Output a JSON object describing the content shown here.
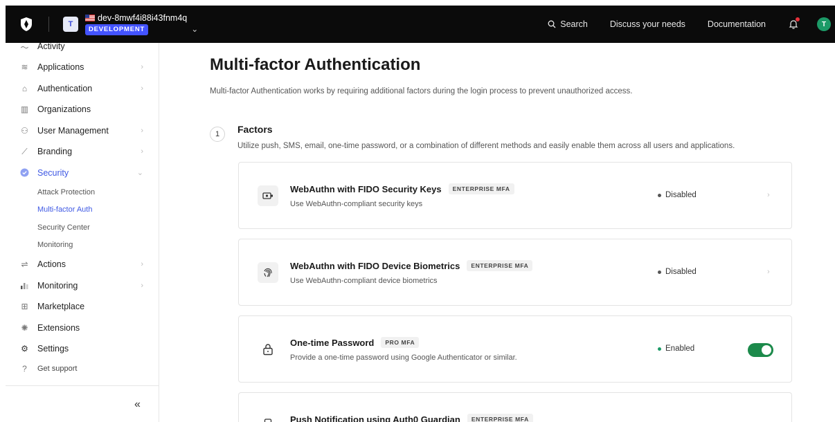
{
  "topbar": {
    "tenant_initial": "T",
    "tenant_name": "dev-8mwf4i88i43fnm4q",
    "environment": "DEVELOPMENT",
    "search_label": "Search",
    "discuss_label": "Discuss your needs",
    "docs_label": "Documentation",
    "user_initial": "T"
  },
  "sidebar": {
    "items": [
      {
        "label": "Activity",
        "icon": "activity-icon"
      },
      {
        "label": "Applications",
        "icon": "layers-icon"
      },
      {
        "label": "Authentication",
        "icon": "lock-icon"
      },
      {
        "label": "Organizations",
        "icon": "building-icon"
      },
      {
        "label": "User Management",
        "icon": "users-icon"
      },
      {
        "label": "Branding",
        "icon": "brush-icon"
      },
      {
        "label": "Security",
        "icon": "shield-check-icon"
      }
    ],
    "security_sub": [
      "Attack Protection",
      "Multi-factor Auth",
      "Security Center",
      "Monitoring"
    ],
    "items_after": [
      {
        "label": "Actions",
        "icon": "actions-icon"
      },
      {
        "label": "Monitoring",
        "icon": "bar-chart-icon"
      },
      {
        "label": "Marketplace",
        "icon": "grid-plus-icon"
      },
      {
        "label": "Extensions",
        "icon": "puzzle-icon"
      },
      {
        "label": "Settings",
        "icon": "gear-icon"
      },
      {
        "label": "Get support",
        "icon": "help-icon"
      }
    ],
    "collapse_glyph": "«"
  },
  "main": {
    "title": "Multi-factor Authentication",
    "description": "Multi-factor Authentication works by requiring additional factors during the login process to prevent unauthorized access.",
    "section": {
      "number": "1",
      "title": "Factors",
      "description": "Utilize push, SMS, email, one-time password, or a combination of different methods and easily enable them across all users and applications."
    },
    "factors": [
      {
        "title": "WebAuthn with FIDO Security Keys",
        "badge": "ENTERPRISE MFA",
        "description": "Use WebAuthn-compliant security keys",
        "status": "Disabled",
        "icon": "security-key-icon"
      },
      {
        "title": "WebAuthn with FIDO Device Biometrics",
        "badge": "ENTERPRISE MFA",
        "description": "Use WebAuthn-compliant device biometrics",
        "status": "Disabled",
        "icon": "fingerprint-icon"
      },
      {
        "title": "One-time Password",
        "badge": "PRO MFA",
        "description": "Provide a one-time password using Google Authenticator or similar.",
        "status": "Enabled",
        "icon": "padlock-icon"
      },
      {
        "title": "Push Notification using Auth0 Guardian",
        "badge": "ENTERPRISE MFA",
        "description": "",
        "status": "",
        "icon": "phone-icon"
      }
    ]
  },
  "colors": {
    "accent": "#3f59e4",
    "enabled": "#1c8a4b",
    "topbar": "#0b0b0b"
  }
}
